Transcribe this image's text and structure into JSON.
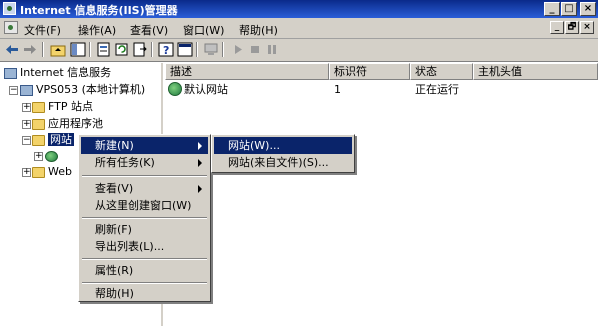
{
  "window": {
    "title": "Internet 信息服务(IIS)管理器",
    "min": "_",
    "max": "□",
    "close": "×"
  },
  "menu": {
    "items": [
      "文件(F)",
      "操作(A)",
      "查看(V)",
      "窗口(W)",
      "帮助(H)"
    ],
    "mdi": [
      "_",
      "🗗",
      "×"
    ]
  },
  "tree": {
    "root": "Internet 信息服务",
    "server": "VPS053 (本地计算机)",
    "ftp": "FTP 站点",
    "pools": "应用程序池",
    "websites": "网站",
    "webext": "Web"
  },
  "list": {
    "columns": [
      "描述",
      "标识符",
      "状态",
      "主机头值"
    ],
    "rows": [
      {
        "desc": "默认网站",
        "id": "1",
        "status": "正在运行",
        "host": ""
      }
    ]
  },
  "context_menu": {
    "items": [
      "新建(N)",
      "所有任务(K)",
      "查看(V)",
      "从这里创建窗口(W)",
      "刷新(F)",
      "导出列表(L)...",
      "属性(R)",
      "帮助(H)"
    ]
  },
  "submenu": {
    "items": [
      "网站(W)...",
      "网站(来自文件)(S)..."
    ]
  },
  "colors": {
    "selection": "#0a246a",
    "face": "#d4d0c8",
    "titlebar": "#0a2a8a"
  }
}
